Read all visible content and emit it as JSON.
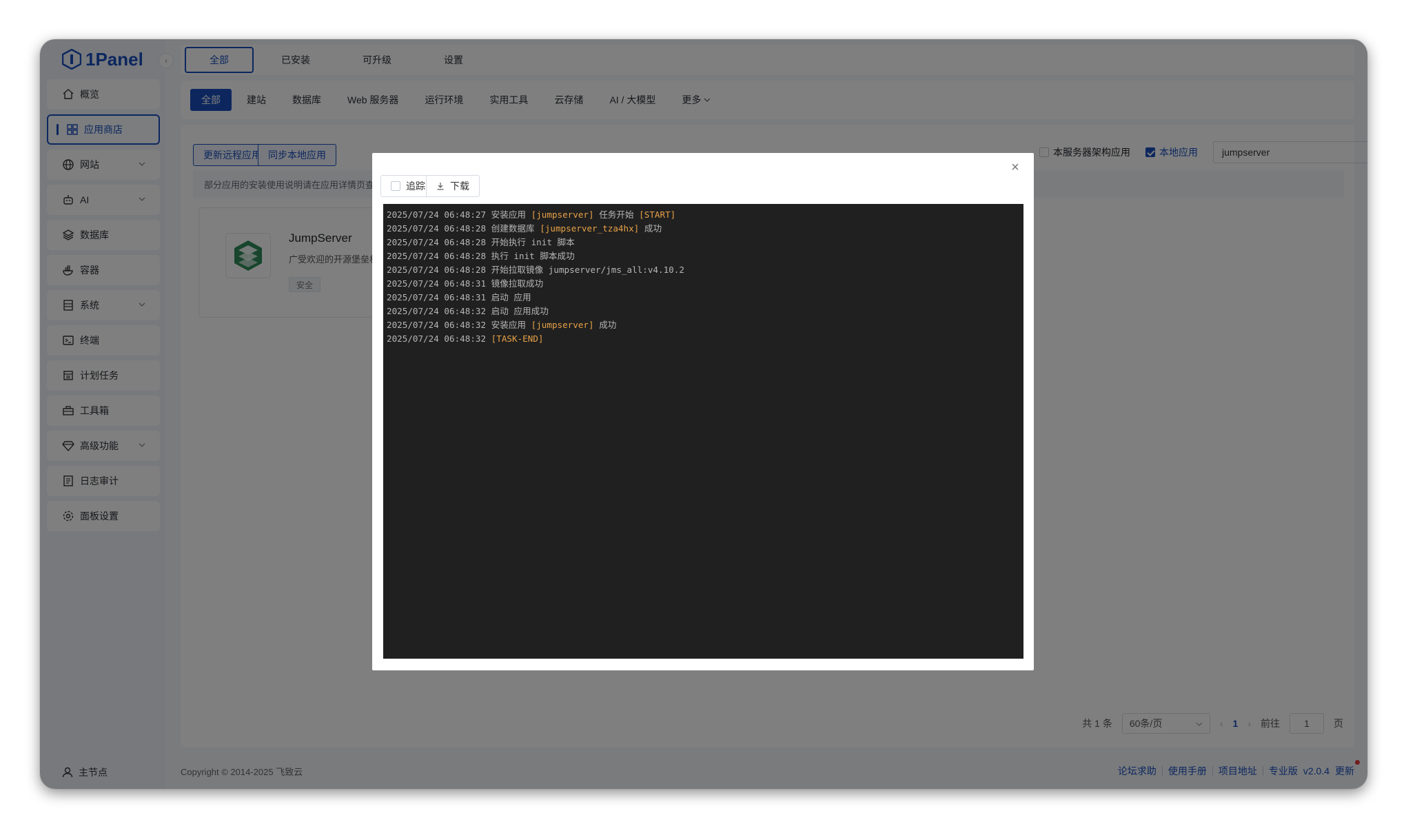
{
  "app": {
    "name": "1Panel"
  },
  "sidebar": {
    "items": [
      {
        "label": "概览",
        "icon": "home-icon",
        "has_children": false
      },
      {
        "label": "应用商店",
        "icon": "grid-icon",
        "has_children": false,
        "active": true
      },
      {
        "label": "网站",
        "icon": "globe-icon",
        "has_children": true
      },
      {
        "label": "AI",
        "icon": "robot-icon",
        "has_children": true
      },
      {
        "label": "数据库",
        "icon": "layers-icon",
        "has_children": false
      },
      {
        "label": "容器",
        "icon": "docker-icon",
        "has_children": false
      },
      {
        "label": "系统",
        "icon": "server-icon",
        "has_children": true
      },
      {
        "label": "终端",
        "icon": "terminal-icon",
        "has_children": false
      },
      {
        "label": "计划任务",
        "icon": "calendar-icon",
        "has_children": false
      },
      {
        "label": "工具箱",
        "icon": "toolbox-icon",
        "has_children": false
      },
      {
        "label": "高级功能",
        "icon": "diamond-icon",
        "has_children": true
      },
      {
        "label": "日志审计",
        "icon": "log-icon",
        "has_children": false
      },
      {
        "label": "面板设置",
        "icon": "gear-icon",
        "has_children": false
      }
    ],
    "footer_label": "主节点"
  },
  "top_tabs": [
    "全部",
    "已安装",
    "可升级",
    "设置"
  ],
  "sub_tabs": [
    "全部",
    "建站",
    "数据库",
    "Web 服务器",
    "运行环境",
    "实用工具",
    "云存储",
    "AI / 大模型",
    "更多"
  ],
  "toolbar": {
    "update_remote": "更新远程应用",
    "sync_local": "同步本地应用",
    "arch_filter": "本服务器架构应用",
    "local_apps": "本地应用",
    "search_value": "jumpserver"
  },
  "notice": "部分应用的安装使用说明请在应用详情页查看",
  "app_card": {
    "name": "JumpServer",
    "desc": "广受欢迎的开源堡垒机",
    "tag": "安全"
  },
  "pagination": {
    "total": "共 1 条",
    "page_size": "60条/页",
    "current": "1",
    "goto_label": "前往",
    "goto_value": "1",
    "page_unit": "页"
  },
  "footer": {
    "copyright": "Copyright © 2014-2025 飞致云",
    "links": [
      "论坛求助",
      "使用手册",
      "项目地址",
      "专业版"
    ],
    "version": "v2.0.4",
    "update": "更新"
  },
  "dialog": {
    "follow_label": "追踪",
    "download_label": "下载",
    "close_icon": "close-icon",
    "log_lines": [
      [
        [
          "2025/07/24 06:48:27 安装应用 ",
          ""
        ],
        [
          "[jumpserver]",
          "hl"
        ],
        [
          " 任务开始 ",
          ""
        ],
        [
          "[START]",
          "hl"
        ]
      ],
      [
        [
          "2025/07/24 06:48:28 创建数据库 ",
          ""
        ],
        [
          "[jumpserver_tza4hx]",
          "hl"
        ],
        [
          " 成功",
          ""
        ]
      ],
      [
        [
          "2025/07/24 06:48:28 开始执行 init 脚本",
          ""
        ]
      ],
      [
        [
          "2025/07/24 06:48:28 执行 init 脚本成功",
          ""
        ]
      ],
      [
        [
          "2025/07/24 06:48:28 开始拉取镜像 jumpserver/jms_all:v4.10.2",
          ""
        ]
      ],
      [
        [
          "2025/07/24 06:48:31 镜像拉取成功",
          ""
        ]
      ],
      [
        [
          "2025/07/24 06:48:31 启动 应用",
          ""
        ]
      ],
      [
        [
          "2025/07/24 06:48:32 启动 应用成功",
          ""
        ]
      ],
      [
        [
          "2025/07/24 06:48:32 安装应用 ",
          ""
        ],
        [
          "[jumpserver]",
          "hl"
        ],
        [
          " 成功",
          ""
        ]
      ],
      [
        [
          "2025/07/24 06:48:32 ",
          ""
        ],
        [
          "[TASK-END]",
          "hl"
        ]
      ]
    ]
  },
  "colors": {
    "accent": "#1a4fbd",
    "log_highlight": "#e7a147",
    "terminal_bg": "#202020"
  }
}
